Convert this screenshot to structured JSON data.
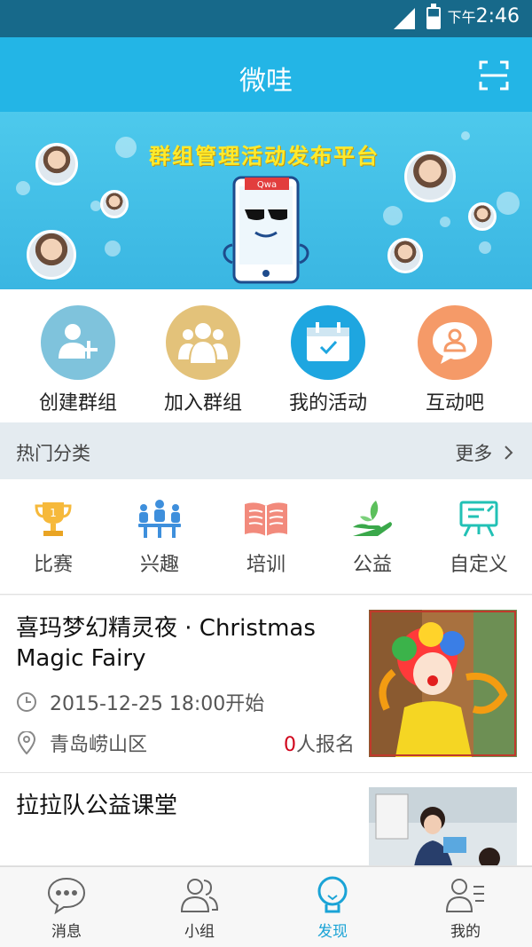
{
  "status_bar": {
    "am_pm": "下午",
    "time": "2:46"
  },
  "header": {
    "title": "微哇",
    "scan_icon": "scan-icon"
  },
  "banner": {
    "slogan": "群组管理活动发布平台",
    "phone_label": "Qwa"
  },
  "quick_actions": [
    {
      "label": "创建群组",
      "icon": "add-user-icon",
      "color": "#7fc3dc"
    },
    {
      "label": "加入群组",
      "icon": "group-icon",
      "color": "#e3c27a"
    },
    {
      "label": "我的活动",
      "icon": "calendar-icon",
      "color": "#1ea6e0"
    },
    {
      "label": "互动吧",
      "icon": "chat-bubble-icon",
      "color": "#f59a68"
    }
  ],
  "categories": {
    "title": "热门分类",
    "more": "更多",
    "items": [
      {
        "label": "比赛",
        "icon": "trophy-icon"
      },
      {
        "label": "兴趣",
        "icon": "people-icon"
      },
      {
        "label": "培训",
        "icon": "book-icon"
      },
      {
        "label": "公益",
        "icon": "charity-icon"
      },
      {
        "label": "自定义",
        "icon": "easel-icon"
      }
    ]
  },
  "activities": [
    {
      "title": "喜玛梦幻精灵夜 · Christmas Magic Fairy",
      "datetime": "2015-12-25  18:00开始",
      "location": "青岛崂山区",
      "signup_count": "0",
      "signup_suffix": "人报名"
    },
    {
      "title": "拉拉队公益课堂"
    }
  ],
  "tabbar": [
    {
      "label": "消息",
      "icon": "message-icon"
    },
    {
      "label": "小组",
      "icon": "group-icon"
    },
    {
      "label": "发现",
      "icon": "bulb-icon",
      "active": true
    },
    {
      "label": "我的",
      "icon": "profile-icon"
    }
  ],
  "colors": {
    "header": "#23b5e6",
    "accent": "#1aa3d6",
    "count_red": "#d0021b"
  }
}
